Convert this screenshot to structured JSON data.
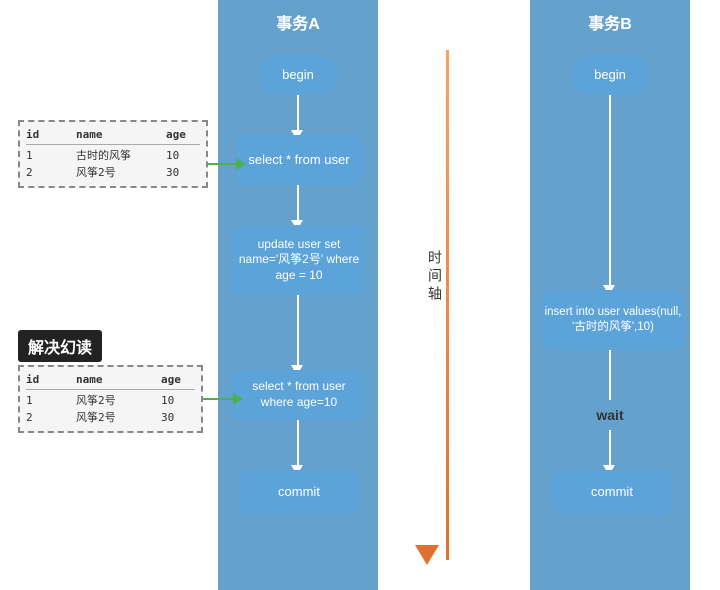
{
  "title": "解决幻读",
  "transaction_a": {
    "header": "事务A",
    "begin": "begin",
    "select1": "select * from user",
    "update": "update user set\nname='风筝2号' where\nage = 10",
    "select2": "select * from user\nwhere age=10",
    "commit": "commit"
  },
  "transaction_b": {
    "header": "事务B",
    "begin": "begin",
    "insert": "insert into user values(null,'\n古时的风筝',10)",
    "wait": "wait",
    "commit": "commit"
  },
  "time_axis_label": "时间轴",
  "table1": {
    "headers": [
      "id",
      "name",
      "age"
    ],
    "rows": [
      [
        "1",
        "古时的风筝",
        "10"
      ],
      [
        "2",
        "风筝2号",
        "30"
      ]
    ]
  },
  "table2": {
    "headers": [
      "id",
      "name",
      "age"
    ],
    "rows": [
      [
        "1",
        "风筝2号",
        "10"
      ],
      [
        "2",
        "风筝2号",
        "30"
      ]
    ]
  },
  "resolve_label": "解决幻读"
}
